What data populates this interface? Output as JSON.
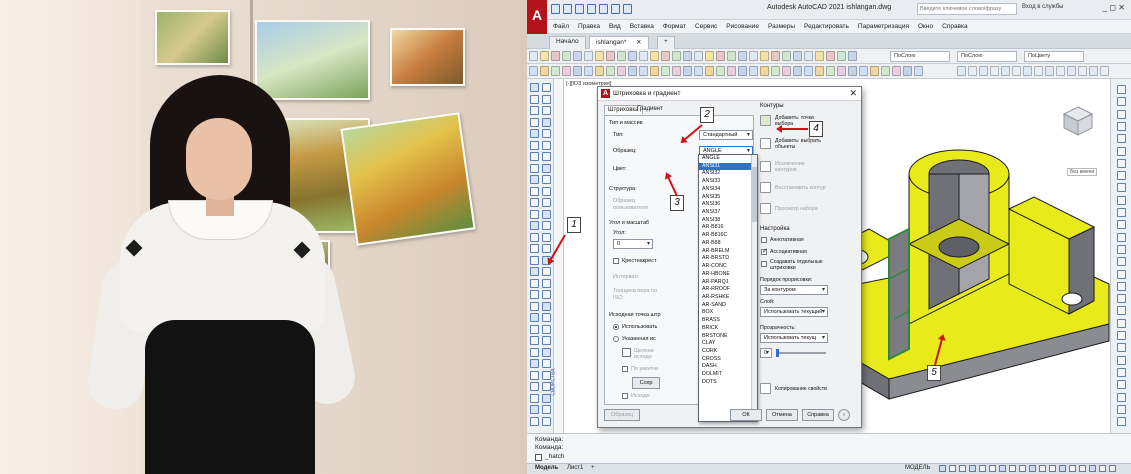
{
  "app": {
    "logo_letter": "A",
    "window_title": "Autodesk AutoCAD 2021   ishlangan.dwg",
    "search_placeholder": "Введите ключевое слово/фразу",
    "login_label": "Вход в службы",
    "window_controls": "_  ◻  ✕"
  },
  "menu": [
    "Файл",
    "Правка",
    "Вид",
    "Вставка",
    "Формат",
    "Сервис",
    "Рисование",
    "Размеры",
    "Редактировать",
    "Параметризация",
    "Окно",
    "Справка"
  ],
  "doc_tabs": {
    "start": "Начало",
    "active": "ishlangan*",
    "close": "✕",
    "add": "+"
  },
  "toolbar": {
    "layer_combo": "ПоСлою",
    "color_combo": "ПоСлою",
    "linetype_combo": "ПоСлою",
    "lineweight_combo": "ПоЦвету"
  },
  "viewport_label": "[-][ЮЗ изометрия]",
  "properties_strip_label": "СВОЙСТВА",
  "dialog": {
    "title": "Штриховка и градиент",
    "close": "✕",
    "tab_hatch": "Штриховка",
    "tab_gradient": "Градиент",
    "type_group": "Тип и массив",
    "type_label": "Тип:",
    "type_value": "Стандартный",
    "pattern_label": "Образец:",
    "pattern_value": "ANGLE",
    "color_label": "Цвет:",
    "structure_label": "Структура:",
    "custom_label_1": "Образец",
    "custom_label_2": "пользователя",
    "angle_group": "Угол и масштаб",
    "angle_label": "Угол:",
    "angle_value": "0",
    "double_label": "Крестнакрест",
    "spacing_label": "Интервал:",
    "iso_label_1": "Толщина пера по",
    "iso_label_2": "ISO:",
    "origin_group": "Исходная точка штр",
    "origin_current": "Использовать",
    "origin_specified": "Указанная ис",
    "origin_click_1": "Щелкни",
    "origin_click_2": "исходн",
    "origin_default": "По умолча",
    "origin_store_btn": "Сохр",
    "origin_store_chk": "Исходн",
    "preview_btn": "Образец",
    "ok_btn": "ОК",
    "cancel_btn": "Отмена",
    "help_btn": "Справка",
    "expand_btn": "›"
  },
  "pattern_list": [
    "ANGLE",
    "ANSI31",
    "ANSI32",
    "ANSI33",
    "ANSI34",
    "ANSI35",
    "ANSI36",
    "ANSI37",
    "ANSI38",
    "AR-B816",
    "AR-B816C",
    "AR-B88",
    "AR-BRELM",
    "AR-BRSTD",
    "AR-CONC",
    "AR-HBONE",
    "AR-PARQ1",
    "AR-RROOF",
    "AR-RSHKE",
    "AR-SAND",
    "BOX",
    "BRASS",
    "BRICK",
    "BRSTONE",
    "CLAY",
    "CORK",
    "CROSS",
    "DASH",
    "DOLMIT",
    "DOTS"
  ],
  "selected_pattern": "ANSI31",
  "boundaries": {
    "title": "Контуры",
    "add_pick_1": "Добавить: точки",
    "add_pick_2": "выбора",
    "add_select_1": "Добавить: выбрать",
    "add_select_2": "объекты",
    "remove_1": "Исключение",
    "remove_2": "контуров",
    "recreate": "Восстановить контур",
    "view": "Просмотр набора"
  },
  "options": {
    "title": "Настройка",
    "annotative": "Аннотативная",
    "associative": "Ассоциативная",
    "separate_1": "Создавать отдельные",
    "separate_2": "штриховки",
    "draw_order_label": "Порядок прорисовки:",
    "draw_order_value": "За контуром",
    "layer_label": "Слой:",
    "layer_value": "Использовать текущий",
    "transparency_label": "Прозрачность:",
    "transparency_value": "Использовать текущ",
    "transparency_num": "0",
    "inherit": "Копирование свойств"
  },
  "callouts": [
    "1",
    "2",
    "3",
    "4",
    "5"
  ],
  "viewcube_label": "Без имени",
  "command": {
    "line1": "Команда:",
    "line2": "Команда:",
    "prompt": "_hatch"
  },
  "status": {
    "model": "Модель",
    "layout1": "Лист1",
    "add": "+",
    "scale": "МОДЕЛЬ"
  },
  "colors": {
    "autocad_red": "#b3141b",
    "part_yellow": "#e8ea1a",
    "part_shadow": "#6f7177",
    "hatch_highlight": "#2c8a3a",
    "selection_blue": "#2f6fd6",
    "callout_red": "#d01313"
  }
}
